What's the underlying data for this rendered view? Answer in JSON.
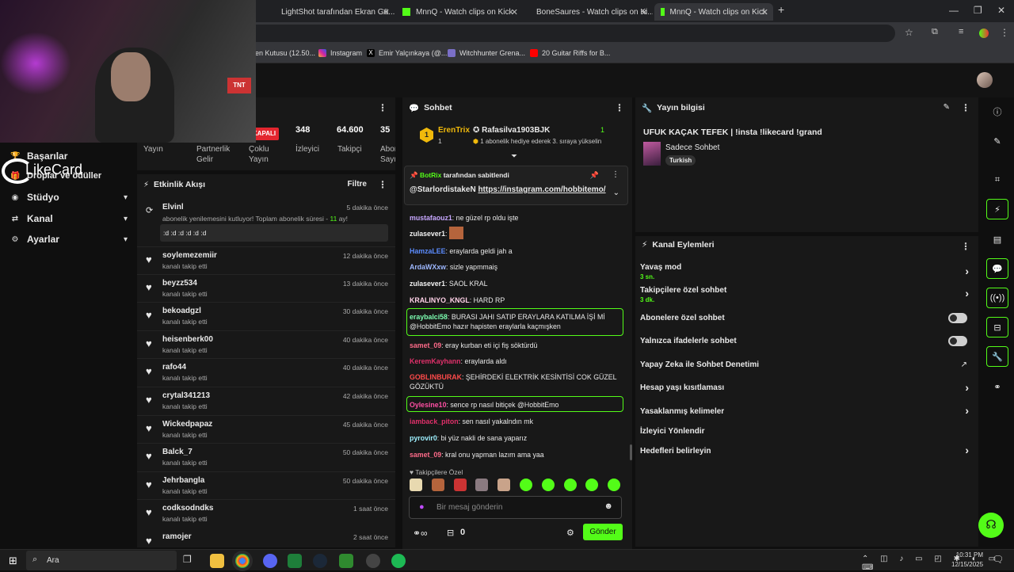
{
  "browser": {
    "tabs": [
      {
        "label": "LightShot tarafından Ekran Gö...",
        "fav": "#8c4fd1"
      },
      {
        "label": "MnnQ - Watch clips on Kick",
        "fav": "#53fc18"
      },
      {
        "label": "BoneSaures - Watch clips on Ki...",
        "fav": "#53fc18"
      },
      {
        "label": "MnnQ - Watch clips on Kick",
        "fav": "#53fc18"
      }
    ],
    "new_tab": "+",
    "bookmarks": [
      "len Kutusu (12.50...",
      "Instagram",
      "Emir Yalçınkaya (@...",
      "Witchhunter Grena...",
      "20 Guitar Riffs for B..."
    ]
  },
  "overlay": {
    "brand": "LikeCard",
    "tnt": "TNT"
  },
  "leftnav": {
    "items": [
      {
        "label": "Başarılar"
      },
      {
        "label": "Droplar ve ödüller"
      },
      {
        "label": "Stüdyo"
      },
      {
        "label": "Kanal"
      },
      {
        "label": "Ayarlar"
      }
    ]
  },
  "stream_panel": {
    "badge": "KAPALI",
    "stats": [
      "348",
      "64.600",
      "35"
    ],
    "labels": [
      "Yayın",
      "Partnerlik Gelir",
      "Çoklu Yayın",
      "İzleyici",
      "Takipçi",
      "Abone Sayısı"
    ]
  },
  "activity": {
    "title": "Etkinlik Akışı",
    "filter": "Filtre",
    "first": {
      "name": "Elvinl",
      "time": "5 dakika önce",
      "text_a": "abonelik yenilemesini kutluyor! Toplam abonelik süresi - ",
      "months": "11",
      "text_b": " ay!",
      "message": ":d :d :d :d :d :d"
    },
    "follows": [
      {
        "name": "soylemezemiir",
        "time": "12 dakika önce"
      },
      {
        "name": "beyzz534",
        "time": "13 dakika önce"
      },
      {
        "name": "bekoadgzl",
        "time": "30 dakika önce"
      },
      {
        "name": "heisenberk00",
        "time": "40 dakika önce"
      },
      {
        "name": "rafo44",
        "time": "40 dakika önce"
      },
      {
        "name": "crytal341213",
        "time": "42 dakika önce"
      },
      {
        "name": "Wickedpapaz",
        "time": "45 dakika önce"
      },
      {
        "name": "Balck_7",
        "time": "50 dakika önce"
      },
      {
        "name": "Jehrbangla",
        "time": "50 dakika önce"
      },
      {
        "name": "codksodndks",
        "time": "1 saat önce"
      },
      {
        "name": "ramojer",
        "time": "2 saat önce"
      }
    ],
    "follow_text": "kanalı takip etti"
  },
  "chat": {
    "title": "Sohbet",
    "top_gifter": {
      "name": "ErenTrix",
      "count": "1"
    },
    "gift_user": {
      "name": "Rafasilva1903BJK",
      "count": "1",
      "text": "1 abonelik hediye ederek 3. sıraya yükselin"
    },
    "pinned": {
      "by": "BotRix",
      "label": "tarafından sabitlendi",
      "user": "@StarlordistakeN",
      "link": "https://instagram.com/hobbitemo/"
    },
    "messages": [
      {
        "user": "mustafaouz1",
        "color": "#c7a7ff",
        "text": "ne güzel rp oldu işte"
      },
      {
        "user": "zulasever1",
        "color": "#f2f2f2",
        "text": ""
      },
      {
        "user": "HamzaLEE",
        "color": "#5b8cff",
        "text": "eraylarda geldi jah a"
      },
      {
        "user": "ArdaWXxw",
        "color": "#9eb8ff",
        "text": "sizle yapmmaiş"
      },
      {
        "user": "zulasever1",
        "color": "#f2f2f2",
        "text": "SAOL KRAL"
      },
      {
        "user": "KRALINYO_KNGL",
        "color": "#ffd1e8",
        "text": "HARD RP"
      },
      {
        "user": "eraybalci58",
        "color": "#7dffb2",
        "text": "BURASI JAHI SATIP ERAYLARA KATILMA İŞİ Mİ @HobbitEmo hazır hapisten eraylarla kaçmışken"
      },
      {
        "user": "samet_09",
        "color": "#ff6b8a",
        "text": "eray kurban eti içi fiş söktürdü"
      },
      {
        "user": "KeremKayhann",
        "color": "#e0306a",
        "text": "eraylarda aldı"
      },
      {
        "user": "GOBLINBURAK",
        "color": "#ff4a4a",
        "text": "ŞEHİRDEKİ ELEKTRİK KESİNTİSİ COK GÜZEL GÖZÜKTÜ"
      },
      {
        "user": "Oylesine10",
        "color": "#ff4fa3",
        "text": "sence rp nasıl bitiçek @HobbitEmo"
      },
      {
        "user": "iamback_piton",
        "color": "#e0306a",
        "text": "sen nasıl yakalndın mk"
      },
      {
        "user": "pyrovir0",
        "color": "#9ef0ff",
        "text": "bi yüz nakli de sana yaparız"
      },
      {
        "user": "samet_09",
        "color": "#ff6b8a",
        "text": "kral onu yapman lazım ama yaa"
      }
    ],
    "followers_only": "Takipçilere Özel",
    "input_placeholder": "Bir mesaj gönderin",
    "points": "0",
    "send": "Gönder"
  },
  "stream_info": {
    "title": "Yayın bilgisi",
    "stream_title": "UFUK KAÇAK TEFEK | !insta !likecard !grand",
    "category": "Sadece Sohbet",
    "tag": "Turkish"
  },
  "channel_actions": {
    "title": "Kanal Eylemleri",
    "items": [
      {
        "label": "Yavaş mod",
        "sub": "3 sn."
      },
      {
        "label": "Takipçilere özel sohbet",
        "sub": "3 dk."
      },
      {
        "label": "Abonelere özel sohbet"
      },
      {
        "label": "Yalnızca ifadelerle sohbet"
      },
      {
        "label": "Yapay Zeka ile Sohbet Denetimi"
      },
      {
        "label": "Hesap yaşı kısıtlaması"
      },
      {
        "label": "Yasaklanmış kelimeler"
      },
      {
        "label": "İzleyici Yönlendir"
      },
      {
        "label": "Hedefleri belirleyin"
      }
    ]
  },
  "taskbar": {
    "search": "Ara",
    "time": "10:31 PM",
    "date": "12/15/2025"
  }
}
